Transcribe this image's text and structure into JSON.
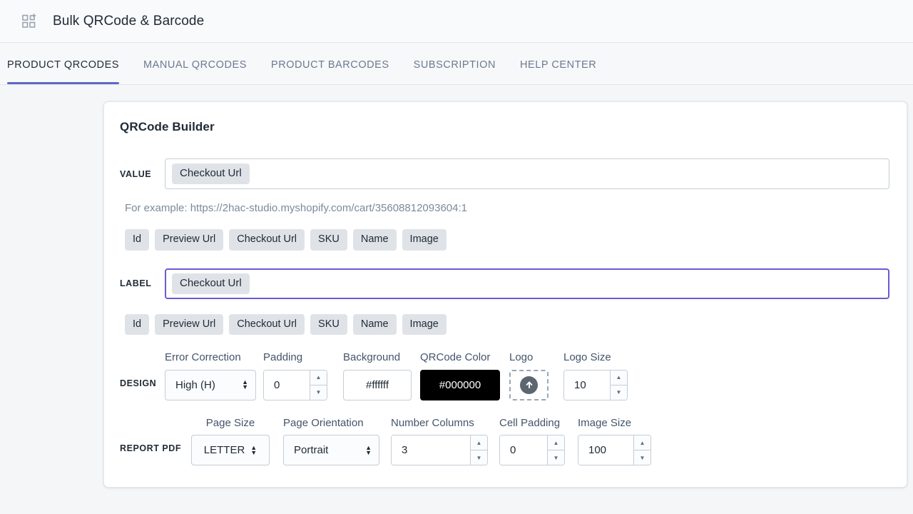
{
  "header": {
    "icon": "grid-plus-icon",
    "title": "Bulk QRCode & Barcode"
  },
  "tabs": [
    {
      "label": "PRODUCT QRCODES",
      "active": true
    },
    {
      "label": "MANUAL QRCODES",
      "active": false
    },
    {
      "label": "PRODUCT BARCODES",
      "active": false
    },
    {
      "label": "SUBSCRIPTION",
      "active": false
    },
    {
      "label": "HELP CENTER",
      "active": false
    }
  ],
  "card": {
    "title": "QRCode Builder",
    "value_field": {
      "label": "VALUE",
      "chip": "Checkout Url",
      "focused": false
    },
    "hint": "For example: https://2hac-studio.myshopify.com/cart/35608812093604:1",
    "value_tokens": [
      "Id",
      "Preview Url",
      "Checkout Url",
      "SKU",
      "Name",
      "Image"
    ],
    "label_field": {
      "label": "LABEL",
      "chip": "Checkout Url",
      "focused": true
    },
    "label_tokens": [
      "Id",
      "Preview Url",
      "Checkout Url",
      "SKU",
      "Name",
      "Image"
    ],
    "design": {
      "row_label": "DESIGN",
      "error_correction": {
        "label": "Error Correction",
        "value": "High (H)"
      },
      "padding": {
        "label": "Padding",
        "value": "0"
      },
      "background": {
        "label": "Background",
        "value": "#ffffff"
      },
      "qrcode_color": {
        "label": "QRCode Color",
        "value": "#000000"
      },
      "logo": {
        "label": "Logo",
        "icon": "upload-arrow-icon"
      },
      "logo_size": {
        "label": "Logo Size",
        "value": "10"
      }
    },
    "report_pdf": {
      "row_label": "REPORT PDF",
      "page_size": {
        "label": "Page Size",
        "value": "LETTER"
      },
      "page_orientation": {
        "label": "Page Orientation",
        "value": "Portrait"
      },
      "number_columns": {
        "label": "Number Columns",
        "value": "3"
      },
      "cell_padding": {
        "label": "Cell Padding",
        "value": "0"
      },
      "image_size": {
        "label": "Image Size",
        "value": "100"
      }
    }
  },
  "colors": {
    "accent": "#5c6ac4",
    "focus_border": "#6b5bd2",
    "background_swatch": "#ffffff",
    "qrcode_swatch": "#000000",
    "page_bg": "#f4f6f8"
  }
}
